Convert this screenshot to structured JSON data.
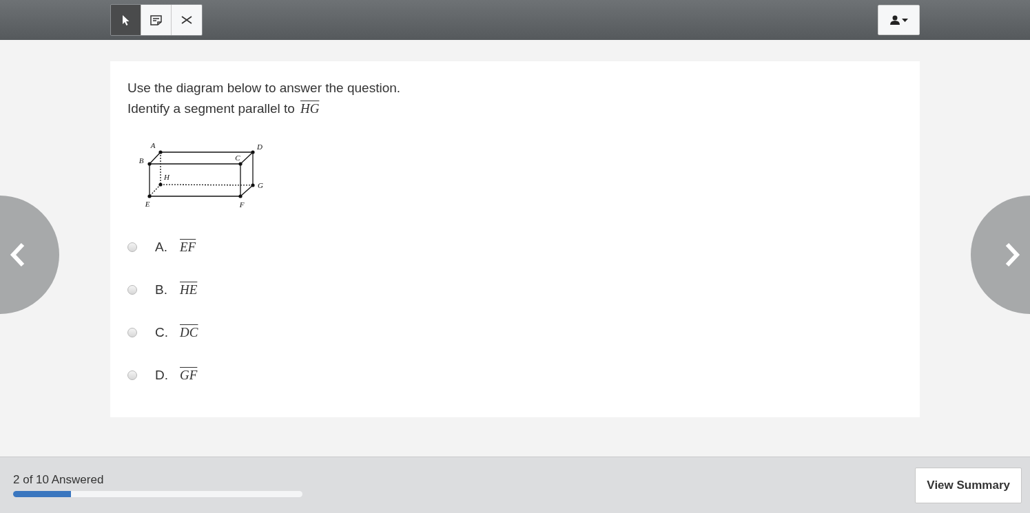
{
  "toolbar": {
    "tools": [
      {
        "kind": "pointer",
        "selected": true
      },
      {
        "kind": "note",
        "selected": false
      },
      {
        "kind": "eliminate",
        "selected": false
      }
    ]
  },
  "question": {
    "lines": [
      "Use the diagram below to answer the question.",
      "Identify a segment parallel to"
    ],
    "segment": "HG",
    "diagram": {
      "points": [
        {
          "label": "A"
        },
        {
          "label": "D"
        },
        {
          "label": "B"
        },
        {
          "label": "C"
        },
        {
          "label": "H"
        },
        {
          "label": "G"
        },
        {
          "label": "E"
        },
        {
          "label": "F"
        }
      ]
    },
    "options": [
      {
        "letter": "A.",
        "segment": "EF",
        "selected": false
      },
      {
        "letter": "B.",
        "segment": "HE",
        "selected": false
      },
      {
        "letter": "C.",
        "segment": "DC",
        "selected": false
      },
      {
        "letter": "D.",
        "segment": "GF",
        "selected": false
      }
    ]
  },
  "footer": {
    "progress_text": "2 of 10 Answered",
    "level": 0.2,
    "button": "View Summary"
  }
}
